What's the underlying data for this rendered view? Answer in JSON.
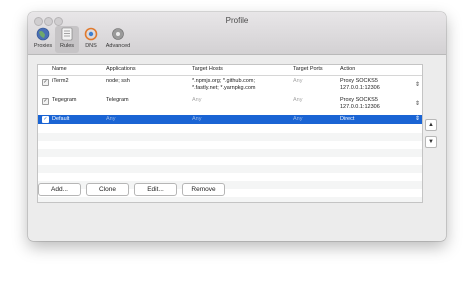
{
  "window": {
    "title": "Profile"
  },
  "toolbar": [
    {
      "label": "Proxies",
      "icon": "globe-icon"
    },
    {
      "label": "Rules",
      "icon": "rules-icon"
    },
    {
      "label": "DNS",
      "icon": "dns-icon"
    },
    {
      "label": "Advanced",
      "icon": "gear-icon"
    }
  ],
  "table": {
    "columns": [
      "Name",
      "Applications",
      "Target Hosts",
      "Target Ports",
      "Action"
    ],
    "rows": [
      {
        "checked": true,
        "name": "iTerm2",
        "applications": "node; ssh",
        "hosts": [
          "*.npmjs.org; *.github.com;",
          "*.fastly.net; *.yarnpkg.com"
        ],
        "ports": "Any",
        "action": [
          "Proxy SOCKS5",
          "127.0.0.1:12306"
        ]
      },
      {
        "checked": true,
        "name": "Tegegram",
        "applications": "Telegram",
        "hosts": [
          "Any"
        ],
        "ports": "Any",
        "action": [
          "Proxy SOCKS5",
          "127.0.0.1:12306"
        ]
      },
      {
        "checked": true,
        "name": "Default",
        "applications": "Any",
        "hosts": [
          "Any"
        ],
        "ports": "Any",
        "action": [
          "Direct"
        ]
      }
    ]
  },
  "buttons": {
    "add": "Add...",
    "clone": "Clone",
    "edit": "Edit...",
    "remove": "Remove"
  },
  "side": {
    "up": "▲",
    "down": "▼"
  },
  "check_glyph": "✓",
  "stepper_glyph": "⇕"
}
